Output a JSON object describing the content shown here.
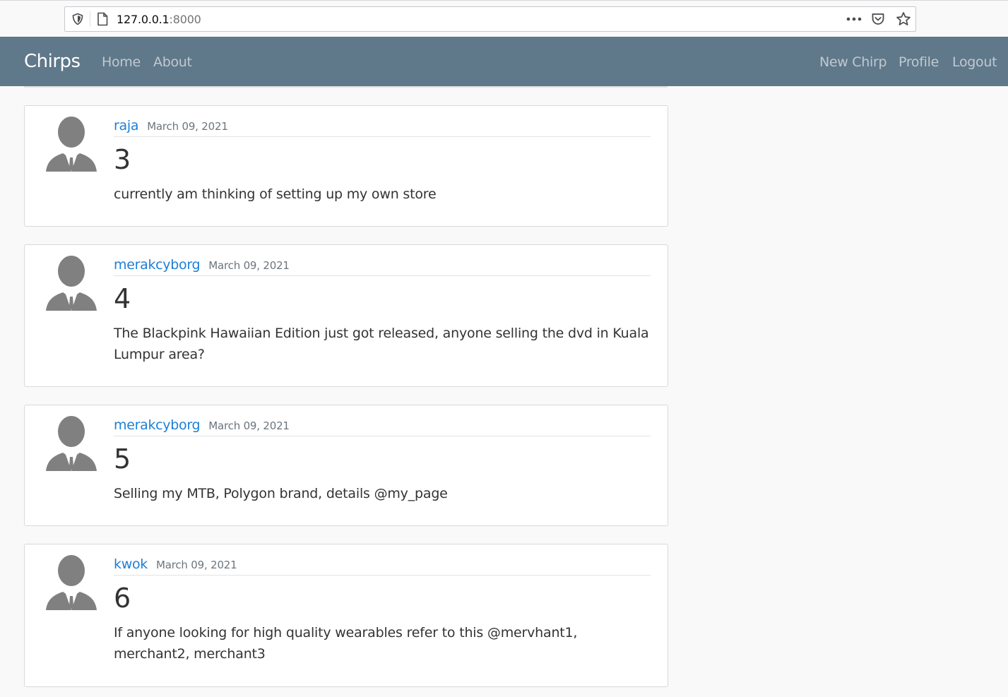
{
  "browser": {
    "url_host": "127.0.0.1",
    "url_port": ":8000"
  },
  "navbar": {
    "brand": "Chirps",
    "left_links": [
      "Home",
      "About"
    ],
    "right_links": [
      "New Chirp",
      "Profile",
      "Logout"
    ]
  },
  "chirps": [
    {
      "username": "raja",
      "date": "March 09, 2021",
      "title": "3",
      "body": "currently am thinking of setting up my own store"
    },
    {
      "username": "merakcyborg",
      "date": "March 09, 2021",
      "title": "4",
      "body": "The Blackpink Hawaiian Edition just got released, anyone selling the dvd in Kuala Lumpur area?"
    },
    {
      "username": "merakcyborg",
      "date": "March 09, 2021",
      "title": "5",
      "body": "Selling my MTB, Polygon brand, details @my_page"
    },
    {
      "username": "kwok",
      "date": "March 09, 2021",
      "title": "6",
      "body": "If anyone looking for high quality wearables refer to this @mervhant1, merchant2, merchant3"
    }
  ]
}
